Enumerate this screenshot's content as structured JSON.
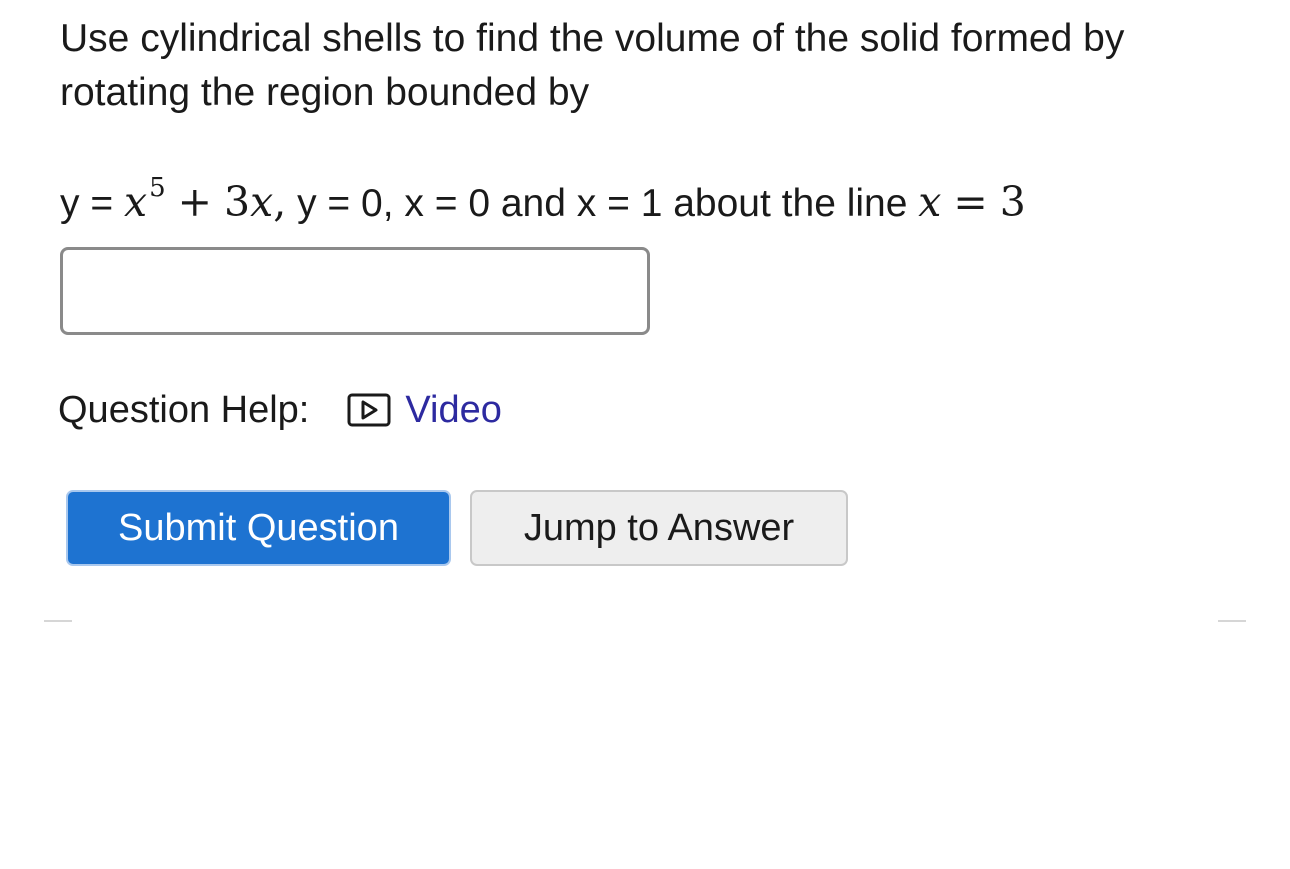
{
  "question": {
    "intro": "Use cylindrical shells to find the volume of the solid formed by rotating the region bounded by",
    "equation": {
      "y_eq": "y = ",
      "term1_var": "x",
      "term1_exp": "5",
      "plus": "+",
      "term2": "3",
      "term2_var": "x",
      "comma1": ",",
      "part2": " y = 0, x = 0 and x = 1 about the line ",
      "axis_var": "x",
      "axis_eq": "=",
      "axis_val": "3"
    }
  },
  "answer_input": {
    "value": "",
    "placeholder": ""
  },
  "help": {
    "label": "Question Help:",
    "video_label": "Video",
    "video_icon": "play-button-icon"
  },
  "buttons": {
    "submit_label": "Submit Question",
    "jump_label": "Jump to Answer"
  },
  "colors": {
    "submit_bg": "#1e73d1",
    "link": "#2d2aa0",
    "input_border": "#8a8a8a"
  }
}
